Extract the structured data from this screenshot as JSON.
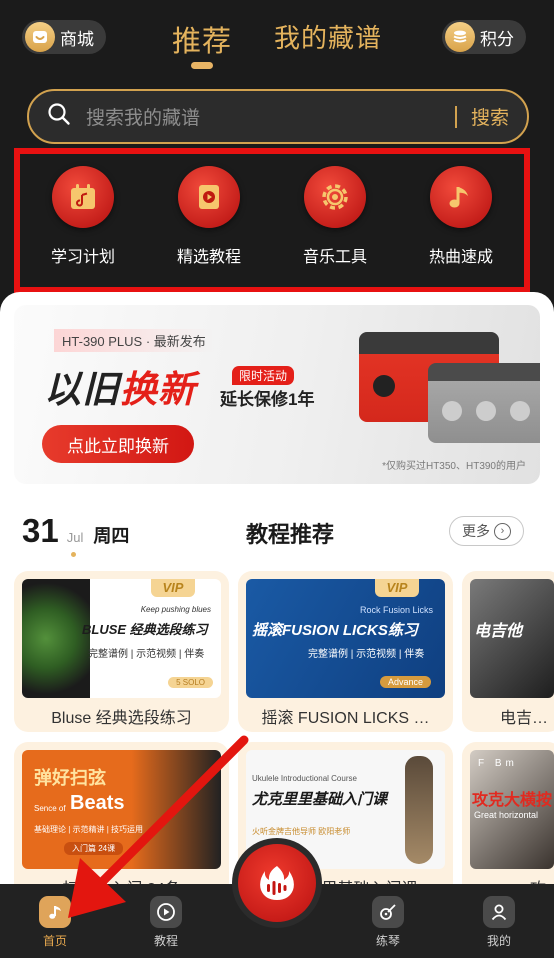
{
  "header": {
    "shop_label": "商城",
    "points_label": "积分",
    "tabs": [
      {
        "label": "推荐",
        "active": true
      },
      {
        "label": "我的藏谱",
        "active": false
      }
    ]
  },
  "search": {
    "placeholder": "搜索我的藏谱",
    "button_label": "搜索"
  },
  "quick_entries": [
    {
      "label": "学习计划",
      "icon": "calendar-music-icon"
    },
    {
      "label": "精选教程",
      "icon": "video-play-icon"
    },
    {
      "label": "音乐工具",
      "icon": "gear-icon"
    },
    {
      "label": "热曲速成",
      "icon": "music-note-icon"
    }
  ],
  "banner": {
    "headline": "HT-390 PLUS · 最新发布",
    "title_a": "以旧",
    "title_b": "换新",
    "tag": "限时活动",
    "subtitle": "延长保修1年",
    "button_label": "点此立即换新",
    "footnote": "*仅购买过HT350、HT390的用户"
  },
  "date": {
    "day": "31",
    "month": "Jul",
    "weekday": "周四"
  },
  "section": {
    "title": "教程推荐",
    "more_label": "更多"
  },
  "cards": [
    {
      "title": "Bluse 经典选段练习",
      "vip": "VIP",
      "thumb_heading": "BLUSE 经典选段练习",
      "thumb_sub": "Keep pushing blues",
      "thumb_desc": "完整谱例 | 示范视频 | 伴奏",
      "thumb_tag": "5 SOLO"
    },
    {
      "title": "摇滚 FUSION LICKS …",
      "vip": "VIP",
      "thumb_heading": "摇滚FUSION LICKS练习",
      "thumb_sub": "Rock Fusion Licks",
      "thumb_desc": "完整谱例 | 示范视频 | 伴奏",
      "thumb_tag": "Advance"
    },
    {
      "title": "电吉他技",
      "thumb_heading": "电吉他"
    },
    {
      "title": "扫弦…入门 24条",
      "thumb_heading": "弹好扫弦",
      "thumb_sub": "Sence of",
      "thumb_sub2": "Beats",
      "thumb_desc": "基础理论 | 示范精讲 | 技巧运用",
      "thumb_tag": "入门篇 24课"
    },
    {
      "title": "尤克里里基础入门课",
      "thumb_heading": "尤克里里基础入门课",
      "thumb_sub": "Ukulele Introductional Course",
      "thumb_desc": "火听金牌吉他导师  欧阳老师"
    },
    {
      "title": "攻克",
      "thumb_heading": "攻克大横按",
      "thumb_sub": "F Bm",
      "thumb_desc": "Great horizontal"
    }
  ],
  "nav": {
    "items": [
      {
        "label": "首页",
        "active": true
      },
      {
        "label": "教程",
        "active": false
      },
      {
        "label": "练琴",
        "active": false
      },
      {
        "label": "我的",
        "active": false
      }
    ]
  },
  "colors": {
    "accent_gold": "#e4b35d",
    "brand_red": "#d21713",
    "highlight_box": "#e81111"
  }
}
